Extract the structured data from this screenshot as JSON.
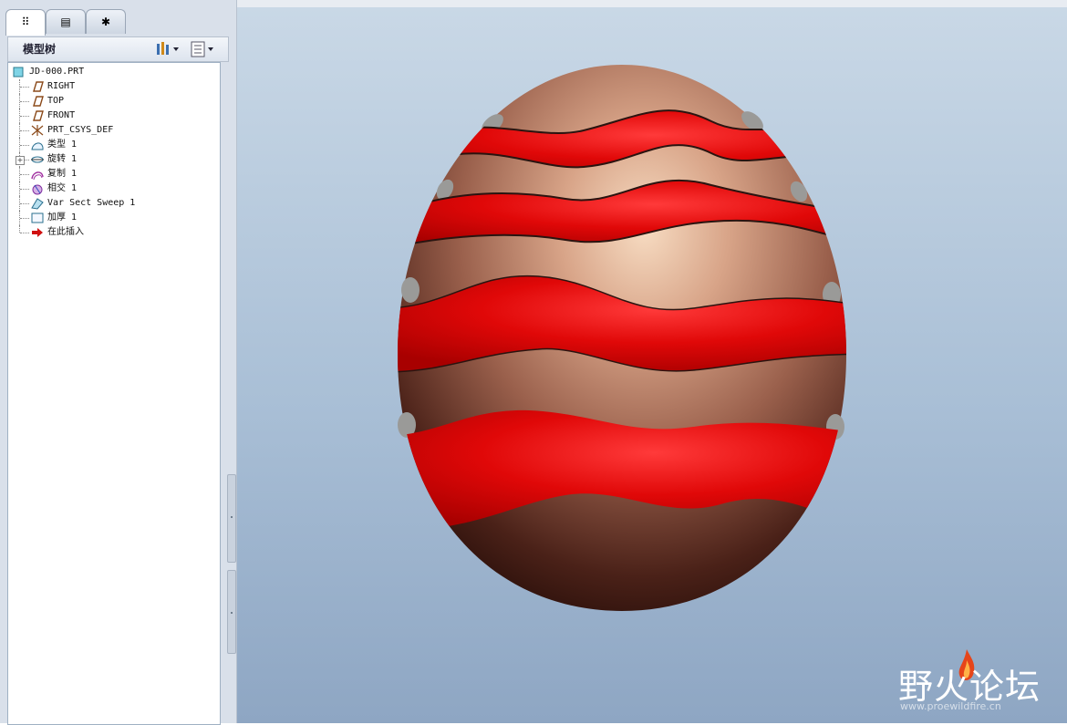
{
  "tabs": [
    {
      "name": "model-tree-tab",
      "icon": "model-tree-icon",
      "glyph": "⠿"
    },
    {
      "name": "layers-tab",
      "icon": "folder-browser-icon",
      "glyph": "▤"
    },
    {
      "name": "favorites-tab",
      "icon": "favorites-icon",
      "glyph": "✱"
    }
  ],
  "tree_header": {
    "title": "模型树",
    "settings_icon": "tools-icon",
    "show_icon": "columns-icon"
  },
  "tree": {
    "root": {
      "label": "JD-000.PRT",
      "icon": "part-icon"
    },
    "items": [
      {
        "label": "RIGHT",
        "icon": "datum-plane-icon",
        "expandable": false
      },
      {
        "label": "TOP",
        "icon": "datum-plane-icon",
        "expandable": false
      },
      {
        "label": "FRONT",
        "icon": "datum-plane-icon",
        "expandable": false
      },
      {
        "label": "PRT_CSYS_DEF",
        "icon": "coordinate-system-icon",
        "expandable": false
      },
      {
        "label": "类型 1",
        "icon": "surface-icon",
        "expandable": false
      },
      {
        "label": "旋转 1",
        "icon": "revolve-icon",
        "expandable": true
      },
      {
        "label": "复制 1",
        "icon": "copy-surface-icon",
        "expandable": false
      },
      {
        "label": "相交 1",
        "icon": "intersect-icon",
        "expandable": false
      },
      {
        "label": "Var Sect Sweep 1",
        "icon": "sweep-icon",
        "expandable": false
      },
      {
        "label": "加厚 1",
        "icon": "thicken-icon",
        "expandable": false
      },
      {
        "label": "在此插入",
        "icon": "insert-here-arrow-icon",
        "expandable": false
      }
    ]
  },
  "watermark": {
    "main": "野火论坛",
    "sub": "www.proewildfire.cn"
  },
  "colors": {
    "egg_base": "#b07a66",
    "stripe": "#e30a0a",
    "viewport_top": "#c9d8e6",
    "viewport_bottom": "#8ea6c3"
  }
}
